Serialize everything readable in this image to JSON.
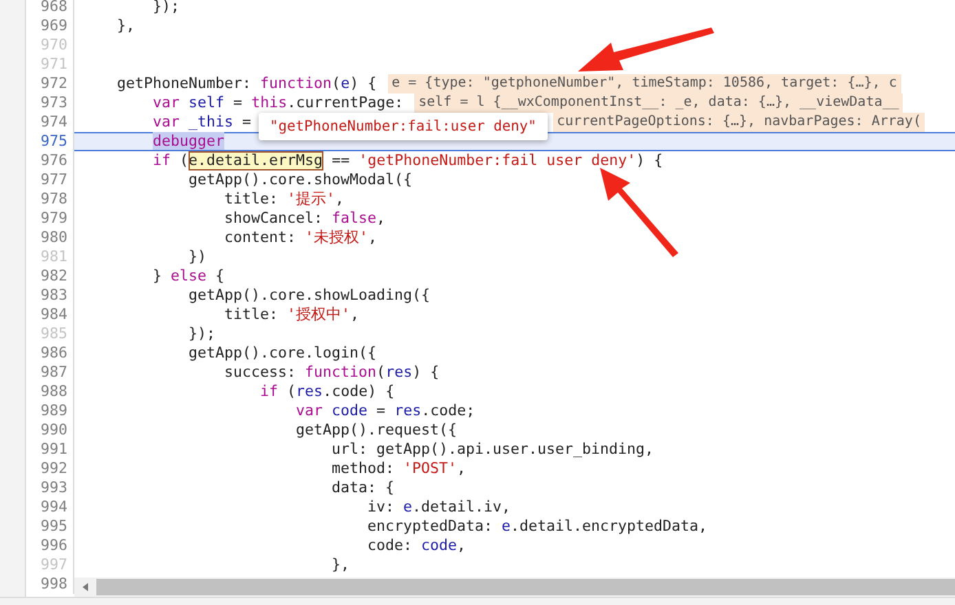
{
  "editor": {
    "lines": [
      {
        "n": "968",
        "faded": false,
        "paused": false,
        "code": [
          {
            "t": "        });",
            "kind": "plain"
          }
        ]
      },
      {
        "n": "969",
        "faded": false,
        "paused": false,
        "code": [
          {
            "t": "    },",
            "kind": "plain"
          }
        ]
      },
      {
        "n": "970",
        "faded": true,
        "paused": false
      },
      {
        "n": "971",
        "faded": true,
        "paused": false
      },
      {
        "n": "972",
        "faded": false,
        "paused": false,
        "code": [
          {
            "t": "    getPhoneNumber: ",
            "kind": "plain"
          },
          {
            "t": "function",
            "kind": "keyword"
          },
          {
            "t": "(",
            "kind": "plain"
          },
          {
            "t": "e",
            "kind": "variable"
          },
          {
            "t": ") {",
            "kind": "plain"
          }
        ],
        "value": {
          "text": "e = {type: \"getphoneNumber\", timeStamp: 10586, target: {…}, c",
          "covered": false
        }
      },
      {
        "n": "973",
        "faded": false,
        "paused": false,
        "code": [
          {
            "t": "        var",
            "kind": "keyword"
          },
          {
            "t": " self",
            "kind": "variable"
          },
          {
            "t": " = ",
            "kind": "plain"
          },
          {
            "t": "this",
            "kind": "keyword"
          },
          {
            "t": ".currentPage:",
            "kind": "plain"
          }
        ],
        "value": {
          "text": "self = l {__wxComponentInst__: _e, data: {…}, __viewData__",
          "covered": false
        }
      },
      {
        "n": "974",
        "faded": false,
        "paused": false,
        "code": [
          {
            "t": "        var",
            "kind": "keyword"
          },
          {
            "t": " _this",
            "kind": "variable"
          },
          {
            "t": " =",
            "kind": "plain"
          }
        ],
        "value": {
          "text": "currentPageOptions: {…}, navbarPages: Array(",
          "covered": true
        }
      },
      {
        "n": "975",
        "faded": false,
        "paused": true,
        "code": [
          {
            "t": "        debugger",
            "kind": "selected"
          }
        ]
      },
      {
        "n": "976",
        "faded": false,
        "paused": false,
        "code": [
          {
            "t": "        if",
            "kind": "keyword"
          },
          {
            "t": " (",
            "kind": "plain"
          },
          {
            "t": "e.detail.errMsg",
            "kind": "hovered"
          },
          {
            "t": " == ",
            "kind": "plain"
          },
          {
            "t": "'getPhoneNumber:fail user deny'",
            "kind": "string"
          },
          {
            "t": ") {",
            "kind": "plain"
          }
        ]
      },
      {
        "n": "977",
        "faded": false,
        "paused": false,
        "code": [
          {
            "t": "            getApp().core.showModal({",
            "kind": "plain"
          }
        ]
      },
      {
        "n": "978",
        "faded": false,
        "paused": false,
        "code": [
          {
            "t": "                title: ",
            "kind": "plain"
          },
          {
            "t": "'提示'",
            "kind": "string"
          },
          {
            "t": ",",
            "kind": "plain"
          }
        ]
      },
      {
        "n": "979",
        "faded": false,
        "paused": false,
        "code": [
          {
            "t": "                showCancel: ",
            "kind": "plain"
          },
          {
            "t": "false",
            "kind": "keyword"
          },
          {
            "t": ",",
            "kind": "plain"
          }
        ]
      },
      {
        "n": "980",
        "faded": false,
        "paused": false,
        "code": [
          {
            "t": "                content: ",
            "kind": "plain"
          },
          {
            "t": "'未授权'",
            "kind": "string"
          },
          {
            "t": ",",
            "kind": "plain"
          }
        ]
      },
      {
        "n": "981",
        "faded": true,
        "paused": false,
        "code": [
          {
            "t": "            })",
            "kind": "plain"
          }
        ]
      },
      {
        "n": "982",
        "faded": false,
        "paused": false,
        "code": [
          {
            "t": "        } ",
            "kind": "plain"
          },
          {
            "t": "else",
            "kind": "keyword"
          },
          {
            "t": " {",
            "kind": "plain"
          }
        ]
      },
      {
        "n": "983",
        "faded": false,
        "paused": false,
        "code": [
          {
            "t": "            getApp().core.showLoading({",
            "kind": "plain"
          }
        ]
      },
      {
        "n": "984",
        "faded": false,
        "paused": false,
        "code": [
          {
            "t": "                title: ",
            "kind": "plain"
          },
          {
            "t": "'授权中'",
            "kind": "string"
          },
          {
            "t": ",",
            "kind": "plain"
          }
        ]
      },
      {
        "n": "985",
        "faded": true,
        "paused": false,
        "code": [
          {
            "t": "            });",
            "kind": "plain"
          }
        ]
      },
      {
        "n": "986",
        "faded": false,
        "paused": false,
        "code": [
          {
            "t": "            getApp().core.login({",
            "kind": "plain"
          }
        ]
      },
      {
        "n": "987",
        "faded": false,
        "paused": false,
        "code": [
          {
            "t": "                success: ",
            "kind": "plain"
          },
          {
            "t": "function",
            "kind": "keyword"
          },
          {
            "t": "(",
            "kind": "plain"
          },
          {
            "t": "res",
            "kind": "variable"
          },
          {
            "t": ") {",
            "kind": "plain"
          }
        ]
      },
      {
        "n": "988",
        "faded": false,
        "paused": false,
        "code": [
          {
            "t": "                    if",
            "kind": "keyword"
          },
          {
            "t": " (",
            "kind": "plain"
          },
          {
            "t": "res",
            "kind": "variable"
          },
          {
            "t": ".code) {",
            "kind": "plain"
          }
        ]
      },
      {
        "n": "989",
        "faded": false,
        "paused": false,
        "code": [
          {
            "t": "                        var",
            "kind": "keyword"
          },
          {
            "t": " code",
            "kind": "variable"
          },
          {
            "t": " = ",
            "kind": "plain"
          },
          {
            "t": "res",
            "kind": "variable"
          },
          {
            "t": ".code;",
            "kind": "plain"
          }
        ]
      },
      {
        "n": "990",
        "faded": false,
        "paused": false,
        "code": [
          {
            "t": "                        getApp().request({",
            "kind": "plain"
          }
        ]
      },
      {
        "n": "991",
        "faded": false,
        "paused": false,
        "code": [
          {
            "t": "                            url: getApp().api.user.user_binding,",
            "kind": "plain"
          }
        ]
      },
      {
        "n": "992",
        "faded": false,
        "paused": false,
        "code": [
          {
            "t": "                            method: ",
            "kind": "plain"
          },
          {
            "t": "'POST'",
            "kind": "string"
          },
          {
            "t": ",",
            "kind": "plain"
          }
        ]
      },
      {
        "n": "993",
        "faded": false,
        "paused": false,
        "code": [
          {
            "t": "                            data: {",
            "kind": "plain"
          }
        ]
      },
      {
        "n": "994",
        "faded": false,
        "paused": false,
        "code": [
          {
            "t": "                                iv: ",
            "kind": "plain"
          },
          {
            "t": "e",
            "kind": "variable"
          },
          {
            "t": ".detail.iv,",
            "kind": "plain"
          }
        ]
      },
      {
        "n": "995",
        "faded": false,
        "paused": false,
        "code": [
          {
            "t": "                                encryptedData: ",
            "kind": "plain"
          },
          {
            "t": "e",
            "kind": "variable"
          },
          {
            "t": ".detail.encryptedData,",
            "kind": "plain"
          }
        ]
      },
      {
        "n": "996",
        "faded": false,
        "paused": false,
        "code": [
          {
            "t": "                                code: ",
            "kind": "plain"
          },
          {
            "t": "code",
            "kind": "variable"
          },
          {
            "t": ",",
            "kind": "plain"
          }
        ]
      },
      {
        "n": "997",
        "faded": true,
        "paused": false,
        "code": [
          {
            "t": "                            },",
            "kind": "plain"
          }
        ]
      },
      {
        "n": "998",
        "faded": false,
        "paused": false
      }
    ]
  },
  "tooltip": {
    "text": "\"getPhoneNumber:fail:user deny\""
  }
}
